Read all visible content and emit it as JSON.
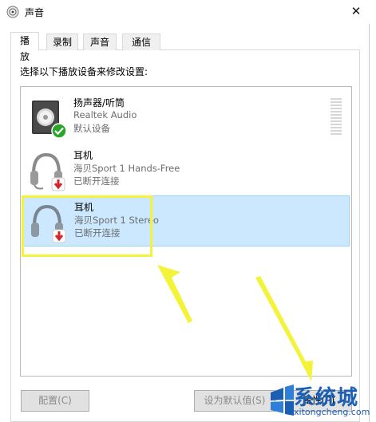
{
  "window": {
    "title": "声音",
    "close_glyph": "✕"
  },
  "tabs": [
    {
      "label": "播放",
      "active": true
    },
    {
      "label": "录制",
      "active": false
    },
    {
      "label": "声音",
      "active": false
    },
    {
      "label": "通信",
      "active": false
    }
  ],
  "instruction": "选择以下播放设备来修改设置:",
  "devices": [
    {
      "name": "扬声器/听筒",
      "line1": "Realtek Audio",
      "line2": "默认设备",
      "icon": "speaker-icon",
      "badge": "default-check-icon",
      "selected": false
    },
    {
      "name": "耳机",
      "line1": "海贝Sport 1 Hands-Free",
      "line2": "已断开连接",
      "icon": "headphones-icon",
      "badge": "disconnected-arrow-icon",
      "selected": false
    },
    {
      "name": "耳机",
      "line1": "海贝Sport 1 Stereo",
      "line2": "已断开连接",
      "icon": "headphones-icon",
      "badge": "disconnected-arrow-icon",
      "selected": true
    }
  ],
  "buttons": {
    "configure": "配置(C)",
    "set_default": "设为默认值(S)",
    "properties": "属性(P)"
  },
  "watermark": {
    "text": "系统城",
    "url": "xitongcheng.com"
  },
  "colors": {
    "selection": "#cce8ff",
    "annotation": "#f3f33a",
    "watermark": "#1a5fb4"
  }
}
